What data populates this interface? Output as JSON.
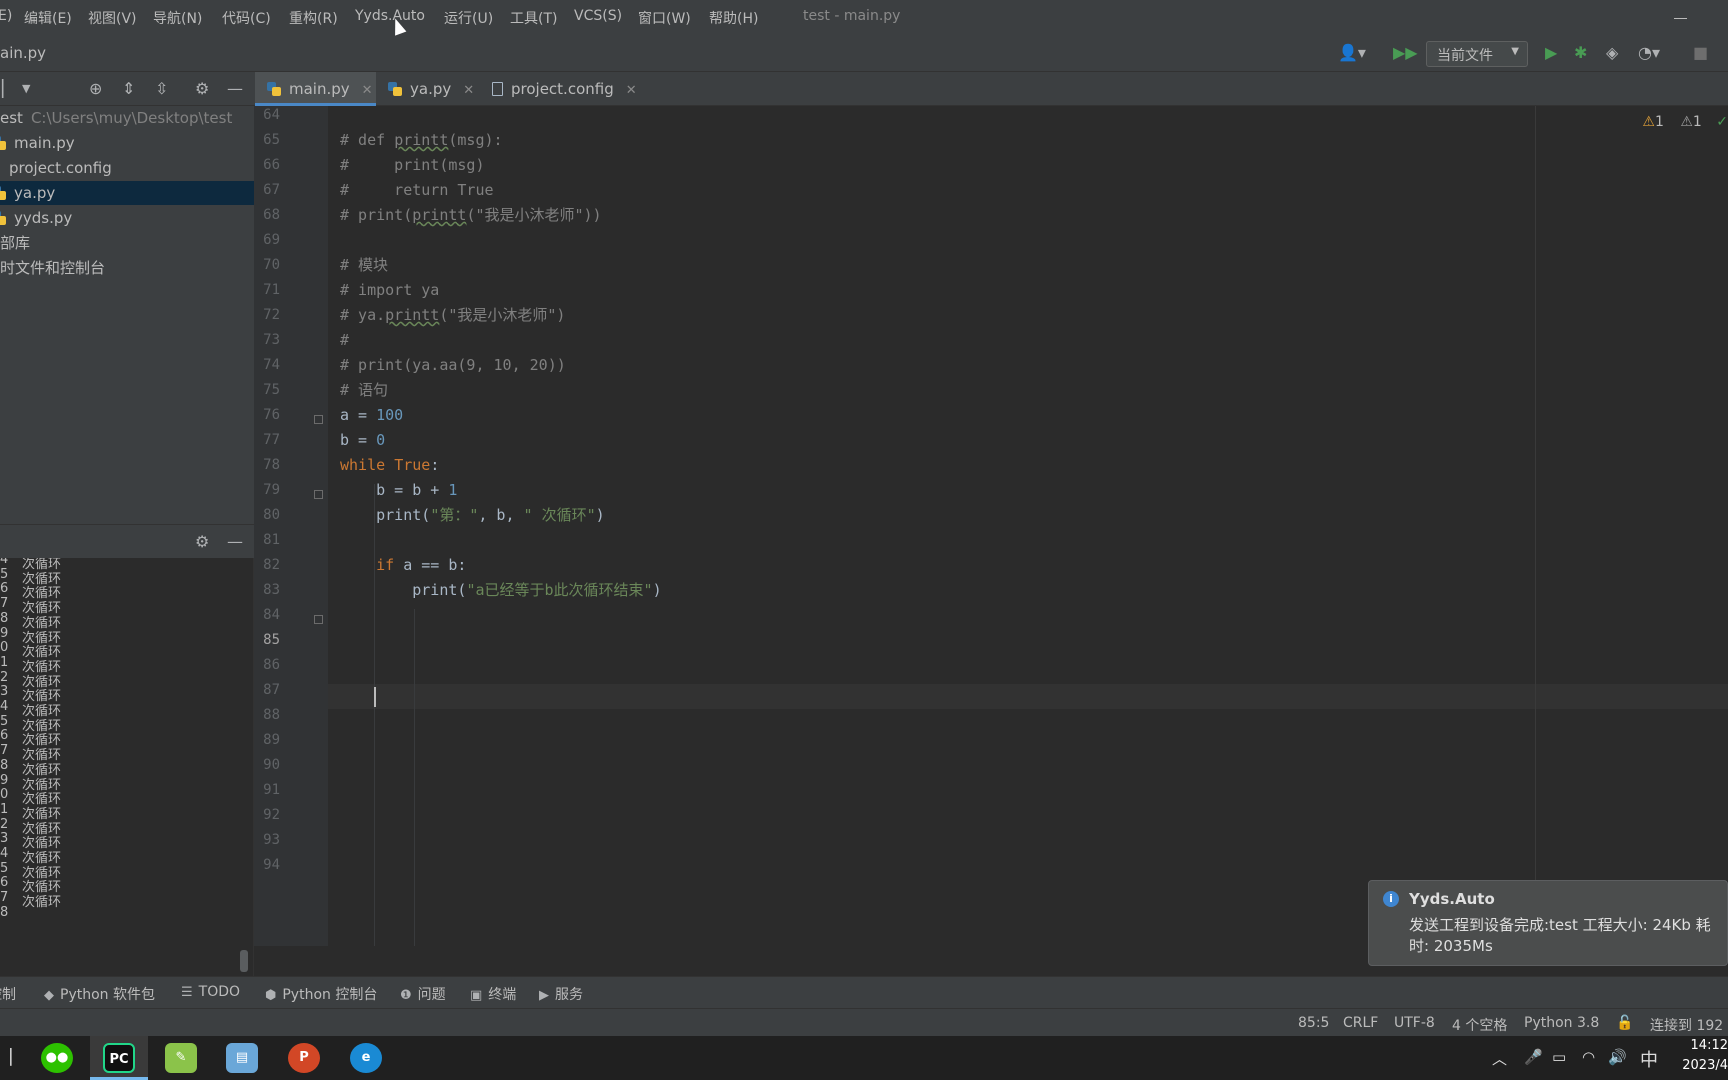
{
  "menubar": {
    "items": [
      "E)",
      "编辑(E)",
      "视图(V)",
      "导航(N)",
      "代码(C)",
      "重构(R)",
      "Yyds.Auto",
      "运行(U)",
      "工具(T)",
      "VCS(S)",
      "窗口(W)",
      "帮助(H)"
    ],
    "window_title": "test - main.py"
  },
  "navbar": {
    "breadcrumb": "ain.py",
    "run_config": "当前文件"
  },
  "project": {
    "root_name": "est",
    "root_path": "C:\\Users\\muy\\Desktop\\test",
    "files": [
      "main.py",
      "project.config",
      "ya.py",
      "yyds.py"
    ],
    "selected": "ya.py",
    "external_libs": "部库",
    "scratches": "时文件和控制台"
  },
  "run_output": {
    "lines": [
      {
        "num": "4",
        "text": "次循环"
      },
      {
        "num": "5",
        "text": "次循环"
      },
      {
        "num": "6",
        "text": "次循环"
      },
      {
        "num": "7",
        "text": "次循环"
      },
      {
        "num": "8",
        "text": "次循环"
      },
      {
        "num": "9",
        "text": "次循环"
      },
      {
        "num": "0",
        "text": "次循环"
      },
      {
        "num": "1",
        "text": "次循环"
      },
      {
        "num": "2",
        "text": "次循环"
      },
      {
        "num": "3",
        "text": "次循环"
      },
      {
        "num": "4",
        "text": "次循环"
      },
      {
        "num": "5",
        "text": "次循环"
      },
      {
        "num": "6",
        "text": "次循环"
      },
      {
        "num": "7",
        "text": "次循环"
      },
      {
        "num": "8",
        "text": "次循环"
      },
      {
        "num": "9",
        "text": "次循环"
      },
      {
        "num": "0",
        "text": "次循环"
      },
      {
        "num": "1",
        "text": "次循环"
      },
      {
        "num": "2",
        "text": "次循环"
      },
      {
        "num": "3",
        "text": "次循环"
      },
      {
        "num": "4",
        "text": "次循环"
      },
      {
        "num": "5",
        "text": "次循环"
      },
      {
        "num": "6",
        "text": "次循环"
      },
      {
        "num": "7",
        "text": "次循环"
      },
      {
        "num": "8",
        "text": ""
      }
    ]
  },
  "tabs": [
    "main.py",
    "ya.py",
    "project.config"
  ],
  "active_tab": "main.py",
  "editor": {
    "line_numbers": [
      "64",
      "65",
      "66",
      "67",
      "68",
      "69",
      "70",
      "71",
      "72",
      "73",
      "74",
      "75",
      "76",
      "77",
      "78",
      "79",
      "80",
      "81",
      "82",
      "83",
      "84",
      "85",
      "86",
      "87",
      "88",
      "89",
      "90",
      "91",
      "92",
      "93",
      "94"
    ],
    "current_line": "85",
    "warnings": "1",
    "weak_warnings": "1",
    "lines": [
      {
        "no": "65",
        "text": "# def printt(msg):"
      },
      {
        "no": "66",
        "text": "#     print(msg)"
      },
      {
        "no": "67",
        "text": "#     return True"
      },
      {
        "no": "68",
        "text": "# print(printt(\"我是小沐老师\"))"
      },
      {
        "no": "70",
        "text": "# 模块"
      },
      {
        "no": "71",
        "text": "# import ya"
      },
      {
        "no": "72",
        "text": "# ya.printt(\"我是小沐老师\")"
      },
      {
        "no": "73",
        "text": "#"
      },
      {
        "no": "74",
        "text": "# print(ya.aa(9, 10, 20))"
      },
      {
        "no": "75",
        "text": "# 语句"
      },
      {
        "no": "76",
        "text": "a = 100"
      },
      {
        "no": "77",
        "text": "b = 0"
      },
      {
        "no": "78",
        "text": "while True:"
      },
      {
        "no": "79",
        "text": "    b = b + 1"
      },
      {
        "no": "80",
        "text": "    print(\"第：\", b, \" 次循环\")"
      },
      {
        "no": "82",
        "text": "    if a == b:"
      },
      {
        "no": "83",
        "text": "        print(\"a已经等于b此次循环结束\")"
      }
    ]
  },
  "notification": {
    "title": "Yyds.Auto",
    "body": "发送工程到设备完成:test 工程大小: 24Kb 耗时: 2035Ms"
  },
  "tool_tabs": [
    "控制",
    "Python 软件包",
    "TODO",
    "Python 控制台",
    "问题",
    "终端",
    "服务"
  ],
  "status": {
    "position": "85:5",
    "line_sep": "CRLF",
    "encoding": "UTF-8",
    "indent": "4 个空格",
    "interpreter": "Python 3.8",
    "connection": "连接到 192"
  },
  "taskbar": {
    "apps": [
      "wechat",
      "pycharm",
      "notepad",
      "notes",
      "powerpoint",
      "edge"
    ],
    "ime": "中",
    "time": "14:12",
    "date": "2023/4"
  },
  "colors": {
    "accent": "#4a88c7",
    "keyword": "#cc7832",
    "string": "#6a8759",
    "number": "#6897bb",
    "comment": "#808080",
    "warning": "#e0a038"
  }
}
